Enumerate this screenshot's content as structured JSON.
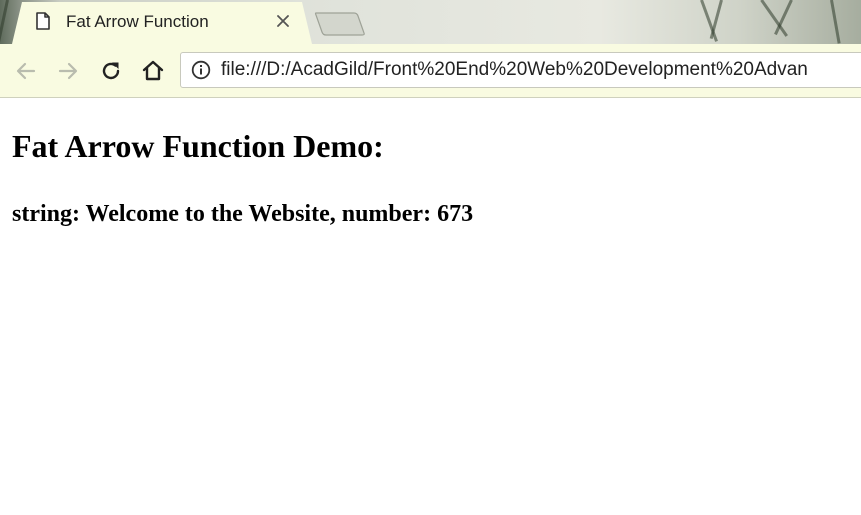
{
  "tab": {
    "title": "Fat Arrow Function",
    "icon": "document-icon",
    "close_icon": "close-icon"
  },
  "toolbar": {
    "back_icon": "back-arrow-icon",
    "forward_icon": "forward-arrow-icon",
    "reload_icon": "reload-icon",
    "home_icon": "home-icon",
    "info_icon": "info-icon",
    "url": "file:///D:/AcadGild/Front%20End%20Web%20Development%20Advan"
  },
  "page": {
    "heading": "Fat Arrow Function Demo:",
    "output": "string: Welcome to the Website, number: 673"
  },
  "colors": {
    "toolbar_bg": "#f9fbe1",
    "page_bg": "#ffffff",
    "text": "#000000"
  }
}
